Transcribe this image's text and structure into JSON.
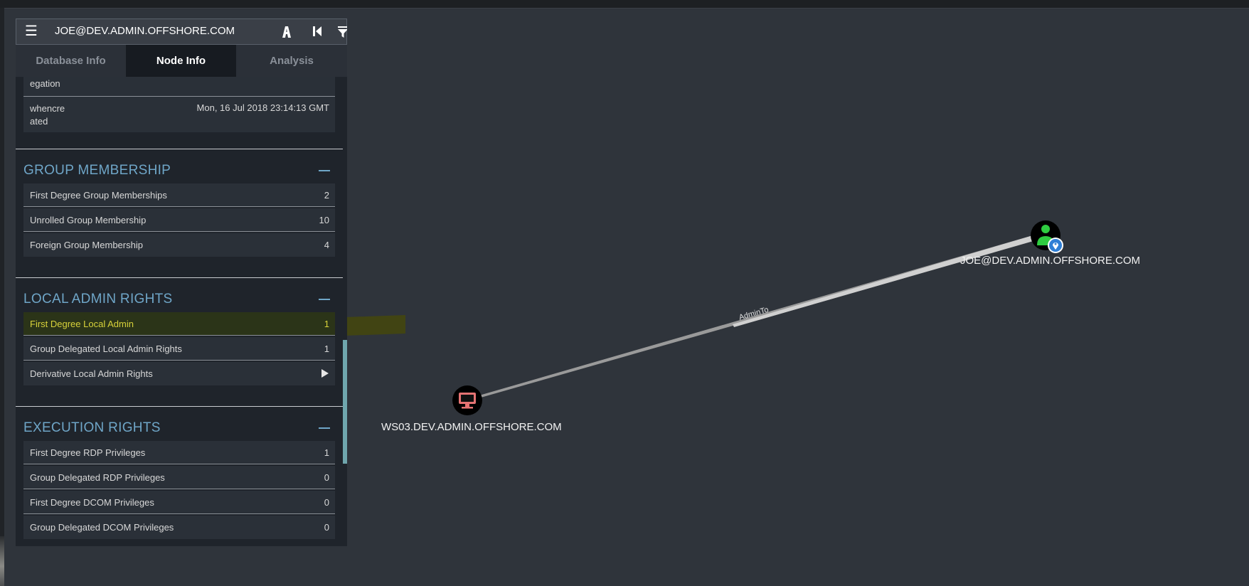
{
  "search": {
    "value": "JOE@DEV.ADMIN.OFFSHORE.COM"
  },
  "tabs": [
    {
      "label": "Database Info"
    },
    {
      "label": "Node Info"
    },
    {
      "label": "Analysis"
    }
  ],
  "properties": [
    {
      "key": "egation",
      "value": ""
    },
    {
      "key": "whencreated",
      "value": "Mon, 16 Jul 2018 23:14:13 GMT"
    }
  ],
  "sections": {
    "group_membership": {
      "title": "GROUP MEMBERSHIP",
      "rows": [
        {
          "label": "First Degree Group Memberships",
          "count": "2"
        },
        {
          "label": "Unrolled Group Membership",
          "count": "10"
        },
        {
          "label": "Foreign Group Membership",
          "count": "4"
        }
      ]
    },
    "local_admin": {
      "title": "LOCAL ADMIN RIGHTS",
      "rows": [
        {
          "label": "First Degree Local Admin",
          "count": "1"
        },
        {
          "label": "Group Delegated Local Admin Rights",
          "count": "1"
        },
        {
          "label": "Derivative Local Admin Rights",
          "count": ""
        }
      ]
    },
    "execution": {
      "title": "EXECUTION RIGHTS",
      "rows": [
        {
          "label": "First Degree RDP Privileges",
          "count": "1"
        },
        {
          "label": "Group Delegated RDP Privileges",
          "count": "0"
        },
        {
          "label": "First Degree DCOM Privileges",
          "count": "0"
        },
        {
          "label": "Group Delegated DCOM Privileges",
          "count": "0"
        }
      ]
    }
  },
  "graph": {
    "nodes": [
      {
        "label": "JOE@DEV.ADMIN.OFFSHORE.COM",
        "type": "user",
        "icon": "user-icon",
        "color": "#2ecc40"
      },
      {
        "label": "WS03.DEV.ADMIN.OFFSHORE.COM",
        "type": "computer",
        "icon": "computer-icon",
        "color": "#e57373"
      }
    ],
    "edge": {
      "label": "AdminTo"
    }
  },
  "colors": {
    "section_heading": "#6fa6c8",
    "highlight": "#d8d23a",
    "panel": "#1f242b"
  }
}
